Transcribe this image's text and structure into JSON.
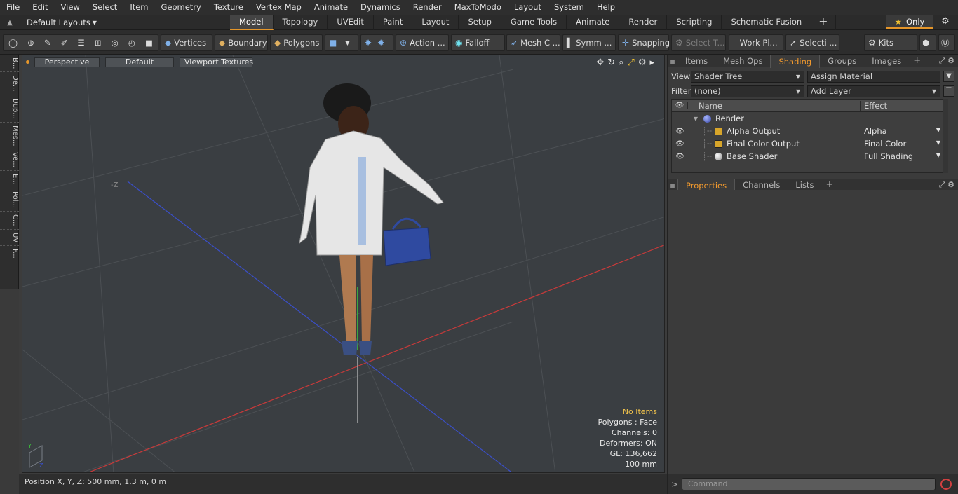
{
  "menu": [
    "File",
    "Edit",
    "View",
    "Select",
    "Item",
    "Geometry",
    "Texture",
    "Vertex Map",
    "Animate",
    "Dynamics",
    "Render",
    "MaxToModo",
    "Layout",
    "System",
    "Help"
  ],
  "layouts_label": "Default Layouts",
  "mode_tabs": [
    "Model",
    "Topology",
    "UVEdit",
    "Paint",
    "Layout",
    "Setup",
    "Game Tools",
    "Animate",
    "Render",
    "Scripting",
    "Schematic Fusion"
  ],
  "only_label": "Only",
  "toolbar": {
    "vertices": "Vertices",
    "boundary": "Boundary",
    "polygons": "Polygons",
    "action": "Action ...",
    "falloff": "Falloff",
    "mesh": "Mesh C ...",
    "symm": "Symm ...",
    "snapping": "Snapping",
    "select_t": "Select T...",
    "work_pl": "Work Pl...",
    "selecti": "Selecti ...",
    "kits": "Kits"
  },
  "left_strip": [
    "B...",
    "De...",
    "Dup...",
    "Mes...",
    "Ve...",
    "E...",
    "Pol...",
    "C...",
    "UV",
    "F..."
  ],
  "viewport": {
    "view": "Perspective",
    "shading": "Default",
    "textures": "Viewport Textures",
    "axis_hint": "-Z",
    "hud": {
      "items": "No Items",
      "polygons": "Polygons : Face",
      "channels": "Channels: 0",
      "deformers": "Deformers: ON",
      "gl": "GL: 136,662",
      "scale": "100 mm"
    }
  },
  "status": "Position X, Y, Z:   500 mm, 1.3 m, 0 m",
  "panel_tabs": [
    "Items",
    "Mesh Ops",
    "Shading",
    "Groups",
    "Images"
  ],
  "view_label": "View",
  "view_value": "Shader Tree",
  "assign_material": "Assign Material",
  "filter_label": "Filter",
  "filter_value": "(none)",
  "add_layer": "Add Layer",
  "tree": {
    "name_header": "Name",
    "effect_header": "Effect",
    "rows": [
      {
        "name": "Render",
        "effect": ""
      },
      {
        "name": "Alpha Output",
        "effect": "Alpha"
      },
      {
        "name": "Final Color Output",
        "effect": "Final Color"
      },
      {
        "name": "Base Shader",
        "effect": "Full Shading"
      }
    ]
  },
  "prop_tabs": [
    "Properties",
    "Channels",
    "Lists"
  ],
  "command_placeholder": "Command",
  "colors": {
    "accent": "#e5962a",
    "x_axis": "#c83a3a",
    "y_axis": "#3cc83c",
    "z_axis": "#3a4fc8"
  }
}
